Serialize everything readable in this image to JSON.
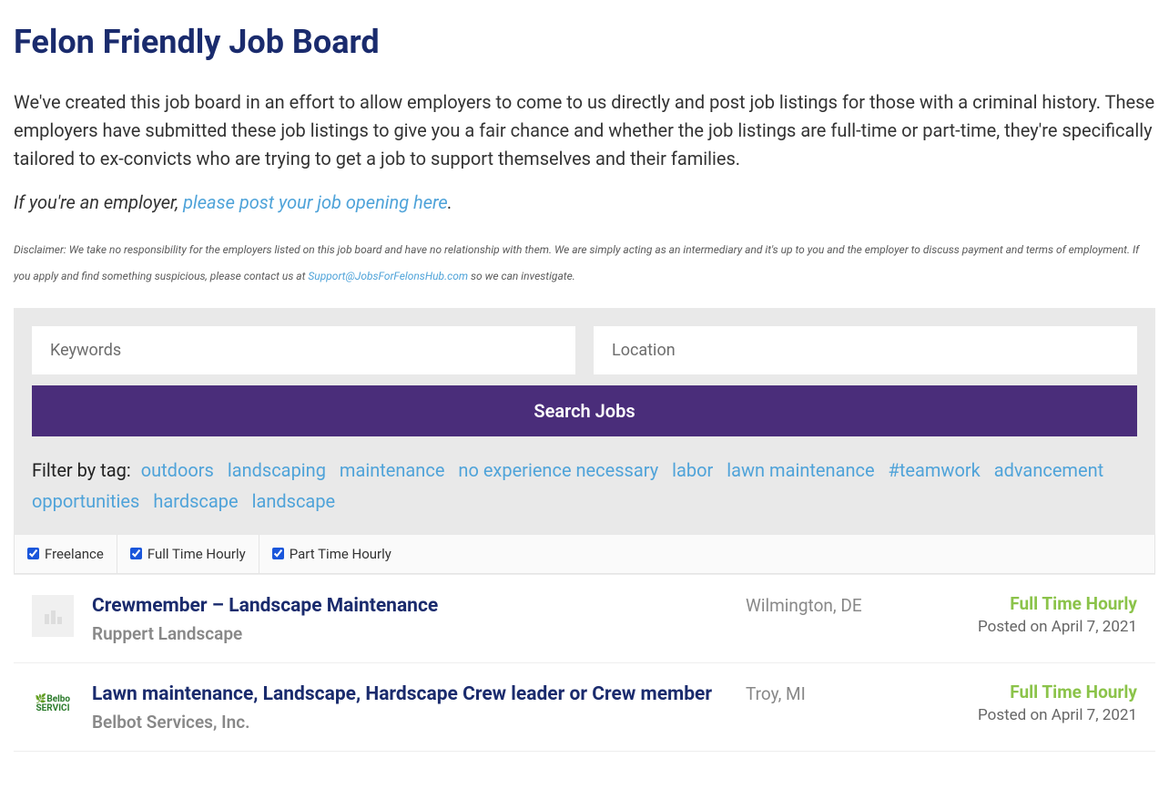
{
  "header": {
    "title": "Felon Friendly Job Board"
  },
  "intro": "We've created this job board in an effort to allow employers to come to us directly and post job listings for those with a criminal history.  These employers have submitted these job listings to give you a fair chance and whether the job listings are full-time or part-time, they're specifically tailored to ex-convicts who are trying to get a job to support themselves and their families.",
  "employerLine": {
    "prefix": "If you're an employer, ",
    "link": "please post your job opening here",
    "suffix": "."
  },
  "disclaimer": {
    "part1": "Disclaimer: We take no responsibility for the employers listed on this job board and have no relationship with them.  We are simply acting as an intermediary and it's up to you and the employer to discuss payment and terms of employment.  If you apply and find something suspicious, please contact us at ",
    "email": "Support@JobsForFelonsHub.com",
    "part2": " so we can investigate."
  },
  "search": {
    "keywordsPlaceholder": "Keywords",
    "locationPlaceholder": "Location",
    "button": "Search Jobs",
    "filterLabel": "Filter by tag:",
    "tags": [
      "outdoors",
      "landscaping",
      "maintenance",
      "no experience necessary",
      "labor",
      "lawn maintenance",
      "#teamwork",
      "advancement",
      "opportunities",
      "hardscape",
      "landscape"
    ]
  },
  "jobTypes": [
    {
      "label": "Freelance",
      "checked": true
    },
    {
      "label": "Full Time Hourly",
      "checked": true
    },
    {
      "label": "Part Time Hourly",
      "checked": true
    }
  ],
  "jobs": [
    {
      "title": "Crewmember – Landscape Maintenance",
      "company": "Ruppert Landscape",
      "location": "Wilmington, DE",
      "type": "Full Time Hourly",
      "posted": "Posted on April 7, 2021",
      "logo": "placeholder"
    },
    {
      "title": "Lawn maintenance, Landscape, Hardscape Crew leader or Crew member",
      "company": "Belbot Services, Inc.",
      "location": "Troy, MI",
      "type": "Full Time Hourly",
      "posted": "Posted on April 7, 2021",
      "logo": "belbot"
    }
  ]
}
